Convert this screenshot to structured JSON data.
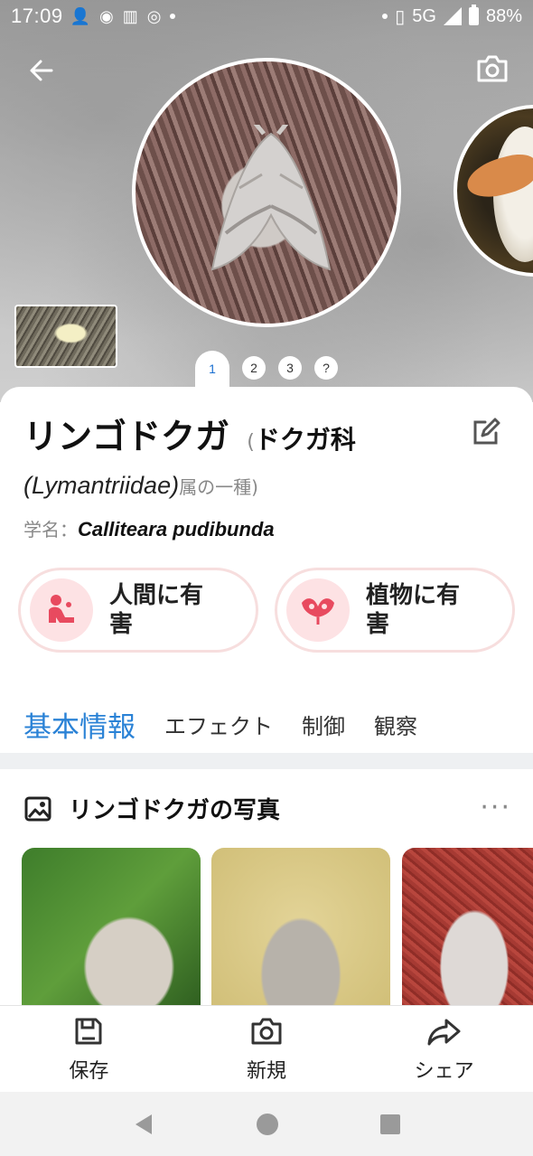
{
  "status_bar": {
    "time": "17:09",
    "network": "5G",
    "battery": "88%"
  },
  "hero": {
    "pager": [
      "1",
      "2",
      "3",
      "?"
    ],
    "active_page": 0
  },
  "species": {
    "name": "リンゴドクガ",
    "paren_open": "(",
    "family_jp": "ドクガ科",
    "family_latin": "(Lymantriidae)",
    "family_suffix": "属の一種)",
    "sci_label": "学名：",
    "sci_name": "Calliteara pudibunda"
  },
  "badges": [
    {
      "label": "人間に有害",
      "line1": "人間に有",
      "line2": "害"
    },
    {
      "label": "植物に有害",
      "line1": "植物に有",
      "line2": "害"
    }
  ],
  "tabs": [
    "基本情報",
    "エフェクト",
    "制御",
    "観察"
  ],
  "photos_section": {
    "title": "リンゴドクガの写真",
    "more": "···"
  },
  "actions": [
    {
      "label": "保存",
      "icon": "save-icon"
    },
    {
      "label": "新規",
      "icon": "camera-icon"
    },
    {
      "label": "シェア",
      "icon": "share-icon"
    }
  ],
  "colors": {
    "accent": "#2a82d6",
    "badge_bg": "#fde2e4",
    "badge_icon": "#e84a5f"
  }
}
